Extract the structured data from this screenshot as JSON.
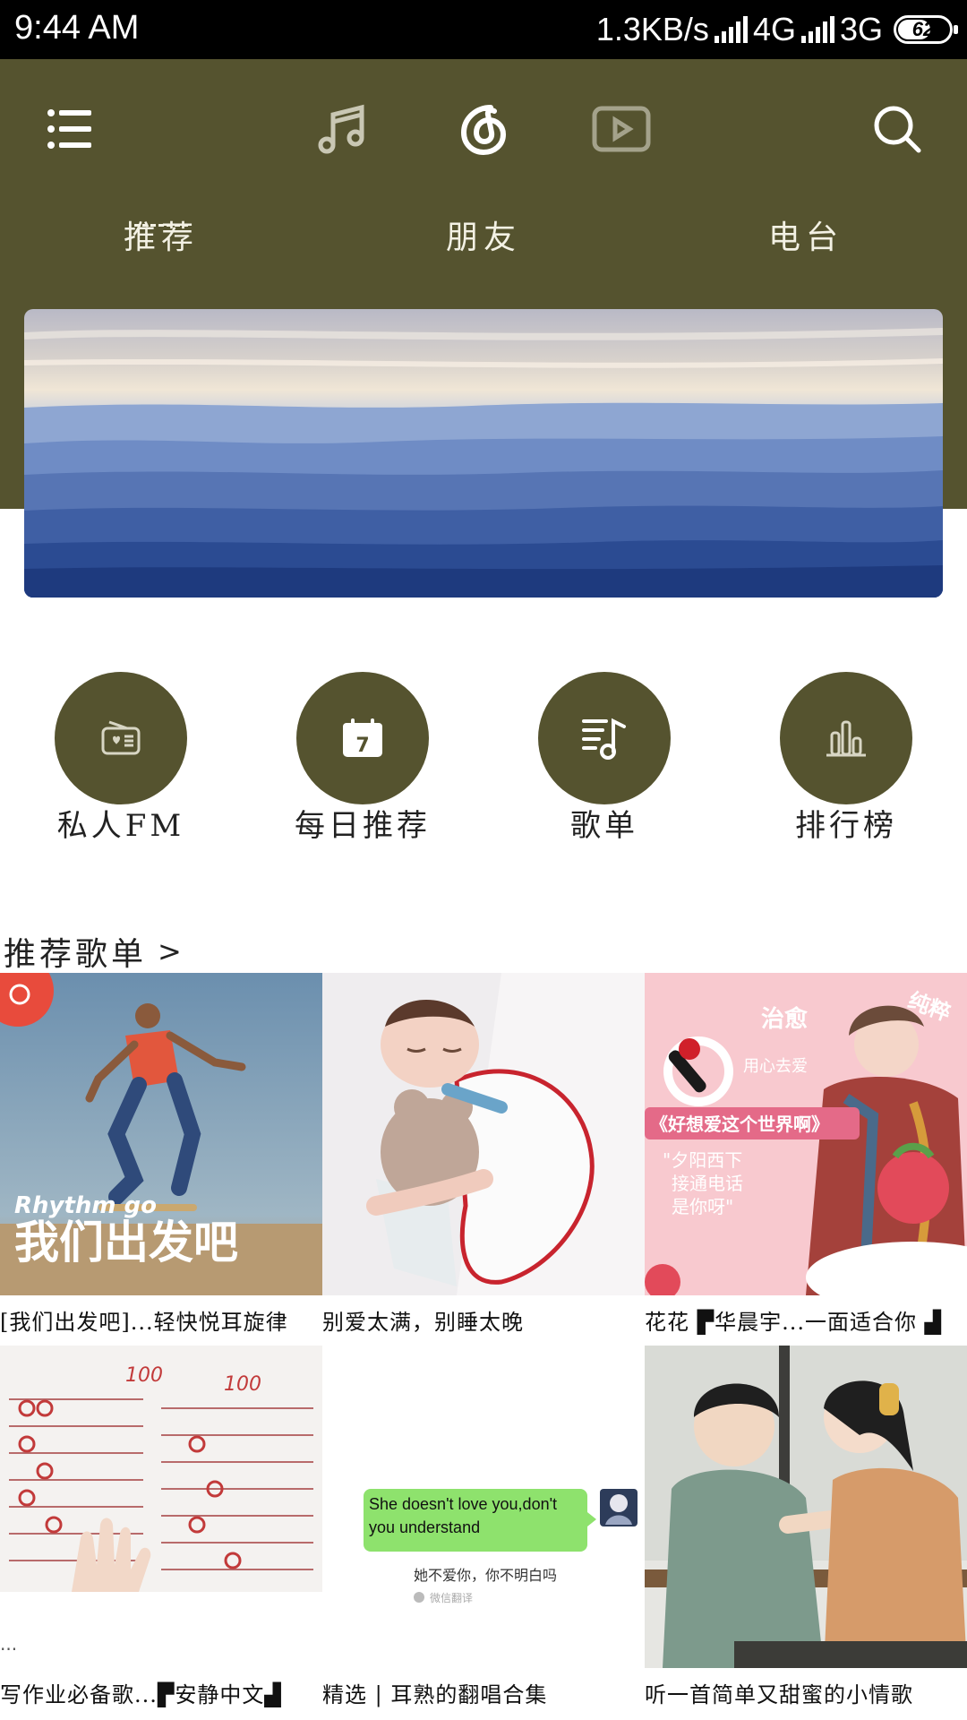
{
  "status_bar": {
    "time": "9:44 AM",
    "net_speed": "1.3KB/s",
    "network1": "4G",
    "network2": "3G",
    "battery": "62",
    "battery_level": 0.62
  },
  "header": {
    "icons": [
      "menu-icon",
      "music-icon",
      "netease-logo-icon",
      "video-icon",
      "search-icon"
    ],
    "tabs": [
      {
        "label": "推荐",
        "active": true
      },
      {
        "label": "朋友",
        "active": false
      },
      {
        "label": "电台",
        "active": false
      }
    ],
    "accent_color": "#55532f"
  },
  "quick_entries": [
    {
      "label": "私人FM",
      "icon": "radio-icon"
    },
    {
      "label": "每日推荐",
      "icon": "calendar-icon"
    },
    {
      "label": "歌单",
      "icon": "playlist-icon"
    },
    {
      "label": "排行榜",
      "icon": "chart-icon"
    }
  ],
  "section": {
    "title": "推荐歌单",
    "arrow": ">"
  },
  "playlists": [
    {
      "title": "[我们出发吧]...轻快悦耳旋律",
      "cover_text1": "Rhythm go",
      "cover_text2": "我们出发吧"
    },
    {
      "title": "别爱太满，别睡太晚"
    },
    {
      "title": "花花 ▛华晨宇...一面适合你 ▟",
      "cover_text1": "《好想爱这个世界啊》",
      "cover_text2": "\"夕阳西下",
      "cover_text3": "接通电话",
      "cover_text4": "是你呀\"",
      "cover_tag1": "治愈",
      "cover_tag2": "用心去爱",
      "cover_tag3": "纯粹"
    },
    {
      "title": "写作业必备歌...▛安静中文▟",
      "cover_text1": "..."
    },
    {
      "title": "精选 | 耳熟的翻唱合集",
      "cover_text1": "She doesn't love you,don't you understand",
      "cover_text2": "她不爱你，你不明白吗",
      "cover_text3": "微信翻译"
    },
    {
      "title": "听一首简单又甜蜜的小情歌"
    }
  ]
}
